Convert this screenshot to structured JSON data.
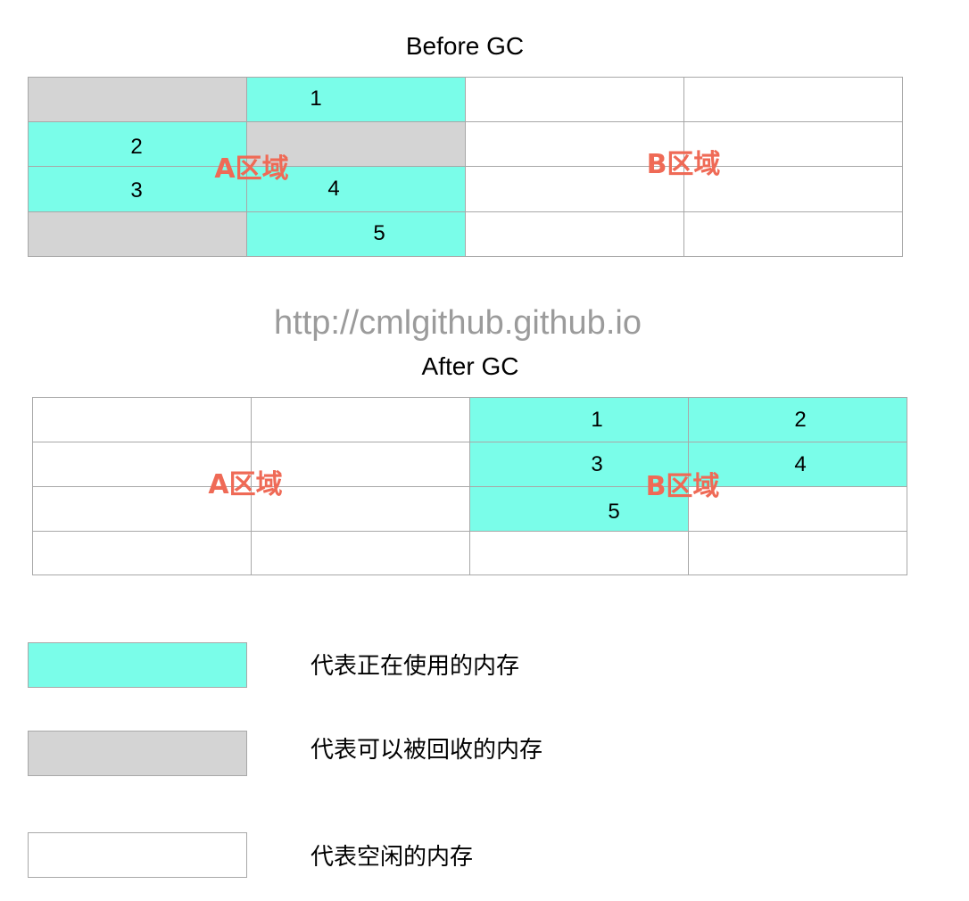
{
  "before": {
    "title": "Before GC",
    "numbers": [
      "1",
      "2",
      "3",
      "4",
      "5"
    ],
    "region_a": "A区域",
    "region_b": "B区域"
  },
  "watermark": "http://cmlgithub.github.io",
  "after": {
    "title": "After GC",
    "numbers": [
      "1",
      "2",
      "3",
      "4",
      "5"
    ],
    "region_a": "A区域",
    "region_b": "B区域"
  },
  "legend": [
    {
      "label": "代表正在使用的内存",
      "color": "#7afde9"
    },
    {
      "label": "代表可以被回收的内存",
      "color": "#d4d4d4"
    },
    {
      "label": "代表空闲的内存",
      "color": "#ffffff"
    }
  ],
  "colors": {
    "used": "#7afde9",
    "reclaimable": "#d4d4d4",
    "free": "#ffffff",
    "region_label": "#ef6a56"
  }
}
